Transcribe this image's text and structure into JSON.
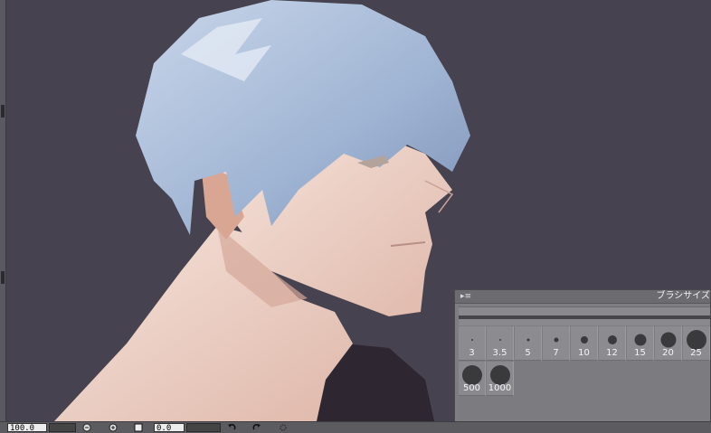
{
  "canvas": {
    "description_icon": "illustration-canvas"
  },
  "bottom_bar": {
    "zoom_value": "100.0",
    "angle_value": "0.0",
    "icons": [
      "zoom-out-icon",
      "zoom-in-icon",
      "fit-screen-icon",
      "undo-icon",
      "redo-icon",
      "settings-icon"
    ]
  },
  "brush_panel": {
    "title": "ブラシサイズ",
    "sizes": [
      {
        "label": "3",
        "dot": 2
      },
      {
        "label": "3.5",
        "dot": 2
      },
      {
        "label": "5",
        "dot": 3
      },
      {
        "label": "7",
        "dot": 5
      },
      {
        "label": "10",
        "dot": 8
      },
      {
        "label": "12",
        "dot": 10
      },
      {
        "label": "15",
        "dot": 13
      },
      {
        "label": "20",
        "dot": 17
      },
      {
        "label": "25",
        "dot": 22
      },
      {
        "label": "500",
        "dot": 22
      },
      {
        "label": "1000",
        "dot": 22
      }
    ]
  },
  "colors": {
    "canvas_bg": "#46424f",
    "hair": "#a9bdd8",
    "skin": "#f1d9cf",
    "panel_bg": "#7e7e82"
  }
}
